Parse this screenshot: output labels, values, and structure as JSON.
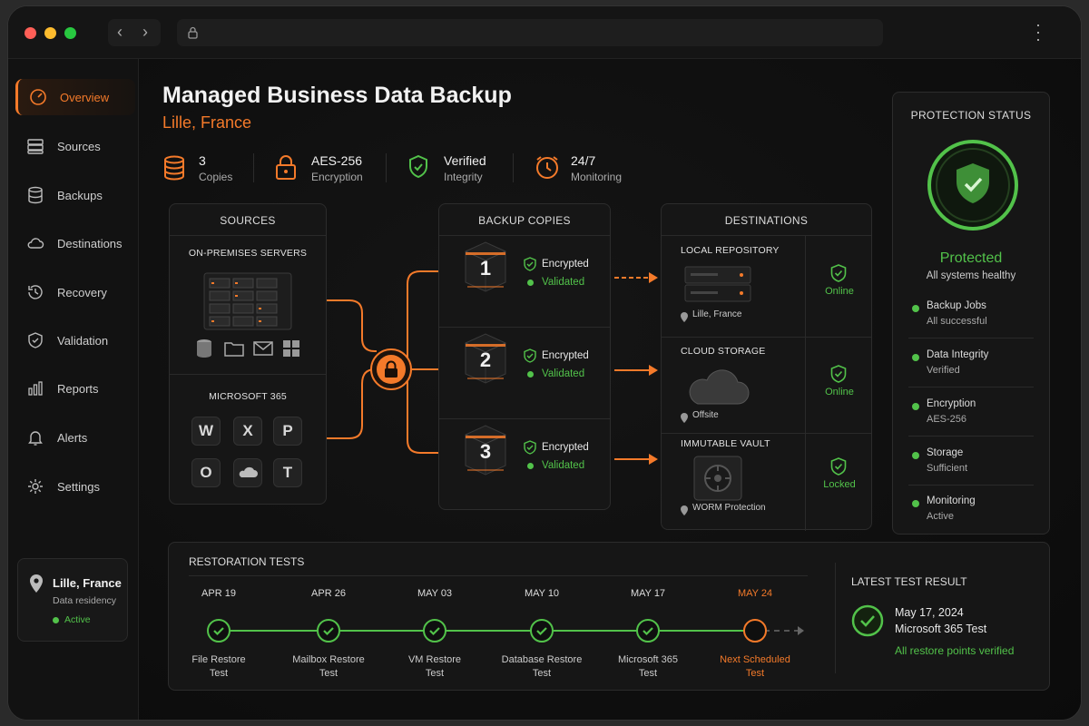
{
  "browser": {
    "back_icon": "chevron-left-icon",
    "forward_icon": "chevron-right-icon",
    "lock_icon": "lock-icon",
    "menu_icon": "kebab-icon"
  },
  "sidebar": {
    "items": [
      {
        "label": "Overview",
        "icon": "speedometer-icon",
        "active": true
      },
      {
        "label": "Sources",
        "icon": "server-icon"
      },
      {
        "label": "Backups",
        "icon": "database-icon"
      },
      {
        "label": "Destinations",
        "icon": "cloud-icon"
      },
      {
        "label": "Recovery",
        "icon": "history-icon"
      },
      {
        "label": "Validation",
        "icon": "shield-icon"
      },
      {
        "label": "Reports",
        "icon": "bar-chart-icon"
      },
      {
        "label": "Alerts",
        "icon": "bell-icon"
      },
      {
        "label": "Settings",
        "icon": "gear-icon"
      }
    ],
    "location": {
      "city": "Lille, France",
      "label": "Data residency",
      "status": "Active"
    }
  },
  "header": {
    "title": "Managed Business Data Backup",
    "subtitle": "Lille, France"
  },
  "stats": [
    {
      "value": "3",
      "label": "Copies"
    },
    {
      "value": "AES-256",
      "label": "Encryption"
    },
    {
      "value": "Verified",
      "label": "Integrity"
    },
    {
      "value": "24/7",
      "label": "Monitoring"
    }
  ],
  "sources": {
    "title": "SOURCES",
    "onprem": "ON-PREMISES SERVERS",
    "m365": "MICROSOFT 365",
    "apps": [
      "W",
      "X",
      "P",
      "O",
      "T"
    ]
  },
  "copies": {
    "title": "BACKUP COPIES",
    "items": [
      {
        "num": "1",
        "encrypted": "Encrypted",
        "validated": "Validated"
      },
      {
        "num": "2",
        "encrypted": "Encrypted",
        "validated": "Validated"
      },
      {
        "num": "3",
        "encrypted": "Encrypted",
        "validated": "Validated"
      }
    ]
  },
  "destinations": {
    "title": "DESTINATIONS",
    "items": [
      {
        "name": "LOCAL REPOSITORY",
        "location": "Lille, France",
        "status": "Online"
      },
      {
        "name": "CLOUD STORAGE",
        "location": "Offsite",
        "status": "Online"
      },
      {
        "name": "IMMUTABLE VAULT",
        "location": "WORM Protection",
        "status": "Locked"
      }
    ]
  },
  "protection": {
    "title": "PROTECTION STATUS",
    "status": "Protected",
    "detail": "All systems healthy",
    "items": [
      {
        "title": "Backup Jobs",
        "value": "All successful"
      },
      {
        "title": "Data Integrity",
        "value": "Verified"
      },
      {
        "title": "Encryption",
        "value": "AES-256"
      },
      {
        "title": "Storage",
        "value": "Sufficient"
      },
      {
        "title": "Monitoring",
        "value": "Active"
      }
    ]
  },
  "restoration": {
    "title": "RESTORATION TESTS",
    "tests": [
      {
        "date": "APR 19",
        "label1": "File Restore",
        "label2": "Test",
        "done": true
      },
      {
        "date": "APR 26",
        "label1": "Mailbox Restore",
        "label2": "Test",
        "done": true
      },
      {
        "date": "MAY 03",
        "label1": "VM Restore",
        "label2": "Test",
        "done": true
      },
      {
        "date": "MAY 10",
        "label1": "Database Restore",
        "label2": "Test",
        "done": true
      },
      {
        "date": "MAY 17",
        "label1": "Microsoft 365",
        "label2": "Test",
        "done": true
      },
      {
        "date": "MAY 24",
        "label1": "Next Scheduled",
        "label2": "Test",
        "done": false
      }
    ],
    "latest": {
      "title": "LATEST TEST RESULT",
      "date": "May 17, 2024",
      "name": "Microsoft 365 Test",
      "result": "All restore points verified"
    }
  },
  "colors": {
    "accent": "#f47a2a",
    "success": "#52c24a",
    "background": "#0c0c0c"
  }
}
